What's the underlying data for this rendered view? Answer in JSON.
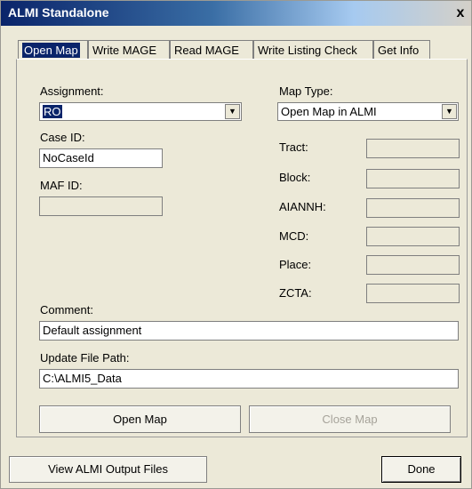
{
  "window": {
    "title": "ALMI Standalone",
    "close_label": "x"
  },
  "tabs": [
    {
      "label": "Open Map"
    },
    {
      "label": "Write MAGE"
    },
    {
      "label": "Read MAGE"
    },
    {
      "label": "Write Listing Check"
    },
    {
      "label": "Get Info"
    }
  ],
  "form": {
    "assignment": {
      "label": "Assignment:",
      "value": "RO"
    },
    "map_type": {
      "label": "Map Type:",
      "value": "Open Map in ALMI"
    },
    "case_id": {
      "label": "Case ID:",
      "value": "NoCaseId"
    },
    "maf_id": {
      "label": "MAF ID:",
      "value": ""
    },
    "tract": {
      "label": "Tract:",
      "value": ""
    },
    "block": {
      "label": "Block:",
      "value": ""
    },
    "aiannh": {
      "label": "AIANNH:",
      "value": ""
    },
    "mcd": {
      "label": "MCD:",
      "value": ""
    },
    "place": {
      "label": "Place:",
      "value": ""
    },
    "zcta": {
      "label": "ZCTA:",
      "value": ""
    },
    "comment": {
      "label": "Comment:",
      "value": "Default assignment"
    },
    "update_path": {
      "label": "Update File Path:",
      "value": "C:\\ALMI5_Data"
    }
  },
  "buttons": {
    "open_map": "Open Map",
    "close_map": "Close Map",
    "view_output": "View ALMI Output Files",
    "done": "Done"
  }
}
